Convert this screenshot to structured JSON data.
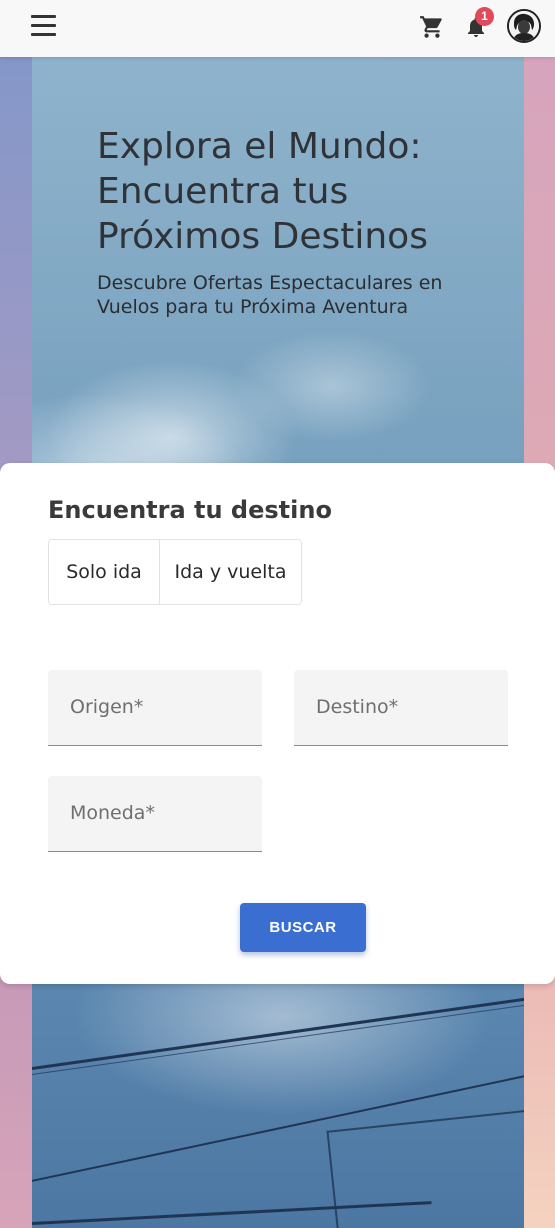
{
  "header": {
    "notification_count": "1"
  },
  "hero": {
    "title": "Explora el Mundo: Encuentra tus Próximos Destinos",
    "subtitle": "Descubre Ofertas Espectaculares en Vuelos para tu Próxima Aventura"
  },
  "search": {
    "title": "Encuentra tu destino",
    "trip_types": [
      "Solo ida",
      "Ida y vuelta"
    ],
    "origin_placeholder": "Origen*",
    "destination_placeholder": "Destino*",
    "currency_placeholder": "Moneda*",
    "submit_label": "BUSCAR"
  },
  "colors": {
    "accent": "#3a6fd1",
    "badge": "#e04a5a"
  },
  "icons": [
    "menu-icon",
    "cart-icon",
    "bell-icon"
  ]
}
